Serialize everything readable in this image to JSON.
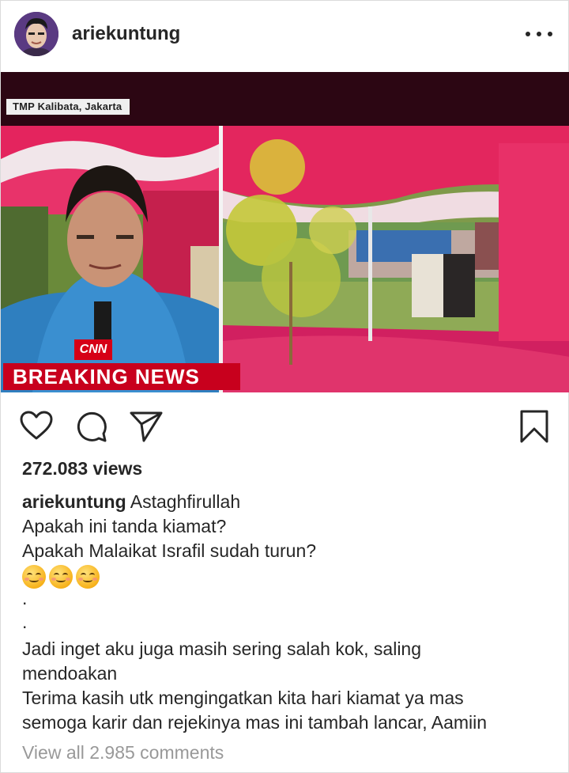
{
  "post": {
    "username": "ariekuntung",
    "more_icon": "more-horizontal-icon"
  },
  "media": {
    "location_label": "TMP Kalibata, Jakarta",
    "network_logo": "CNN",
    "ticker": "BREAKING NEWS"
  },
  "actions": {
    "icons": [
      "heart-icon",
      "comment-icon",
      "share-icon",
      "bookmark-icon"
    ]
  },
  "stats": {
    "views": "272.083 views"
  },
  "caption": {
    "username": "ariekuntung",
    "first_line": "Astaghfirullah",
    "lines": [
      "Apakah ini tanda kiamat?",
      "Apakah Malaikat Israfil sudah turun?"
    ],
    "emojis": [
      "smiling-face-emoji",
      "smiling-face-emoji",
      "smiling-face-emoji"
    ],
    "dots": [
      ".",
      "."
    ],
    "body": [
      "Jadi inget aku juga masih sering salah kok, saling",
      "mendoakan",
      "Terima kasih utk mengingatkan kita hari kiamat ya mas",
      "semoga karir dan rejekinya mas ini tambah lancar, Aamiin"
    ]
  },
  "comments": {
    "view_all": "View all 2.985 comments"
  },
  "colors": {
    "text": "#262626",
    "muted": "#999999",
    "breaking_red": "#c8001d",
    "tent_pink": "#e01a5a"
  }
}
